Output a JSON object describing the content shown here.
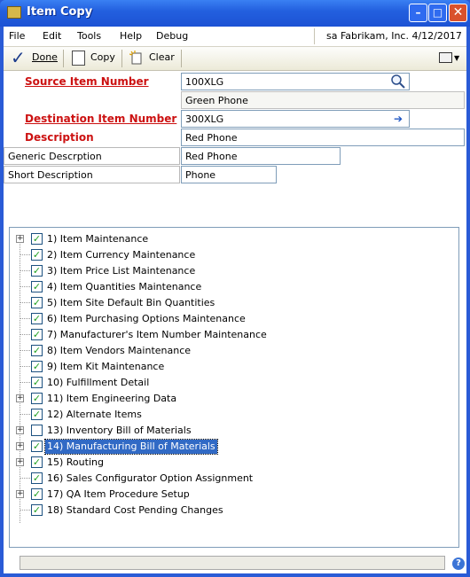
{
  "window": {
    "title": "Item Copy",
    "controls": {
      "minimize": "–",
      "maximize": "□",
      "close": "✕"
    }
  },
  "menubar": {
    "items": [
      "File",
      "Edit",
      "Tools",
      "Help",
      "Debug"
    ],
    "company_info": "sa  Fabrikam, Inc.  4/12/2017"
  },
  "toolbar": {
    "done_label": "Done",
    "copy_label": "Copy",
    "clear_label": "Clear"
  },
  "form": {
    "source_item_label": "Source Item Number",
    "source_item_value": "100XLG",
    "source_item_desc": "Green Phone",
    "dest_item_label": "Destination Item Number",
    "dest_item_value": "300XLG",
    "description_label": "Description",
    "description_value": "Red Phone",
    "generic_desc_label": "Generic Descrption",
    "generic_desc_value": "Red Phone",
    "short_desc_label": "Short Description",
    "short_desc_value": "Phone"
  },
  "tree": {
    "items": [
      {
        "label": "1) Item Maintenance",
        "checked": true,
        "expandable": true
      },
      {
        "label": "2) Item Currency Maintenance",
        "checked": true,
        "expandable": false
      },
      {
        "label": "3) Item Price List Maintenance",
        "checked": true,
        "expandable": false
      },
      {
        "label": "4) Item Quantities Maintenance",
        "checked": true,
        "expandable": false
      },
      {
        "label": "5) Item Site Default Bin Quantities",
        "checked": true,
        "expandable": false
      },
      {
        "label": "6) Item Purchasing Options Maintenance",
        "checked": true,
        "expandable": false
      },
      {
        "label": "7) Manufacturer's Item Number Maintenance",
        "checked": true,
        "expandable": false
      },
      {
        "label": "8) Item Vendors Maintenance",
        "checked": true,
        "expandable": false
      },
      {
        "label": "9) Item Kit Maintenance",
        "checked": true,
        "expandable": false
      },
      {
        "label": "10) Fulfillment Detail",
        "checked": true,
        "expandable": false
      },
      {
        "label": "11) Item Engineering Data",
        "checked": true,
        "expandable": true
      },
      {
        "label": "12) Alternate Items",
        "checked": true,
        "expandable": false
      },
      {
        "label": "13) Inventory Bill of Materials",
        "checked": false,
        "expandable": true
      },
      {
        "label": "14) Manufacturing Bill of Materials",
        "checked": true,
        "expandable": true,
        "selected": true
      },
      {
        "label": "15) Routing",
        "checked": true,
        "expandable": true
      },
      {
        "label": "16) Sales Configurator Option Assignment",
        "checked": true,
        "expandable": false
      },
      {
        "label": "17) QA Item Procedure Setup",
        "checked": true,
        "expandable": true
      },
      {
        "label": "18) Standard Cost Pending Changes",
        "checked": true,
        "expandable": false
      }
    ]
  },
  "colors": {
    "title_bar": "#2360df",
    "required_label": "#cc1111",
    "selection": "#316ac5",
    "check": "#21a121"
  }
}
